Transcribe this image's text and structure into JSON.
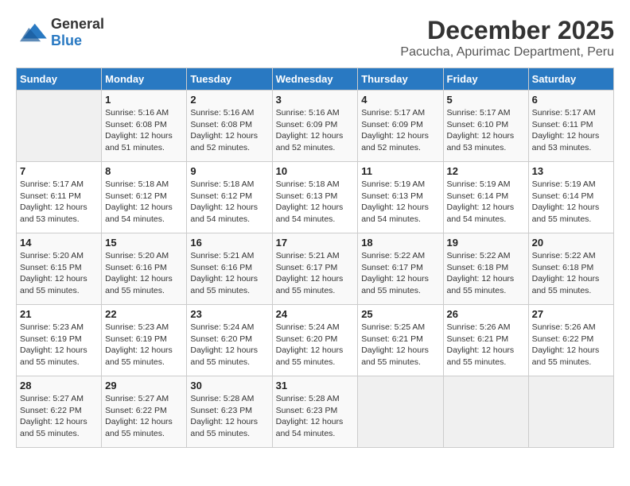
{
  "header": {
    "logo_general": "General",
    "logo_blue": "Blue",
    "month_title": "December 2025",
    "subtitle": "Pacucha, Apurimac Department, Peru"
  },
  "days_of_week": [
    "Sunday",
    "Monday",
    "Tuesday",
    "Wednesday",
    "Thursday",
    "Friday",
    "Saturday"
  ],
  "weeks": [
    [
      {
        "day": "",
        "info": ""
      },
      {
        "day": "1",
        "info": "Sunrise: 5:16 AM\nSunset: 6:08 PM\nDaylight: 12 hours\nand 51 minutes."
      },
      {
        "day": "2",
        "info": "Sunrise: 5:16 AM\nSunset: 6:08 PM\nDaylight: 12 hours\nand 52 minutes."
      },
      {
        "day": "3",
        "info": "Sunrise: 5:16 AM\nSunset: 6:09 PM\nDaylight: 12 hours\nand 52 minutes."
      },
      {
        "day": "4",
        "info": "Sunrise: 5:17 AM\nSunset: 6:09 PM\nDaylight: 12 hours\nand 52 minutes."
      },
      {
        "day": "5",
        "info": "Sunrise: 5:17 AM\nSunset: 6:10 PM\nDaylight: 12 hours\nand 53 minutes."
      },
      {
        "day": "6",
        "info": "Sunrise: 5:17 AM\nSunset: 6:11 PM\nDaylight: 12 hours\nand 53 minutes."
      }
    ],
    [
      {
        "day": "7",
        "info": "Sunrise: 5:17 AM\nSunset: 6:11 PM\nDaylight: 12 hours\nand 53 minutes."
      },
      {
        "day": "8",
        "info": "Sunrise: 5:18 AM\nSunset: 6:12 PM\nDaylight: 12 hours\nand 54 minutes."
      },
      {
        "day": "9",
        "info": "Sunrise: 5:18 AM\nSunset: 6:12 PM\nDaylight: 12 hours\nand 54 minutes."
      },
      {
        "day": "10",
        "info": "Sunrise: 5:18 AM\nSunset: 6:13 PM\nDaylight: 12 hours\nand 54 minutes."
      },
      {
        "day": "11",
        "info": "Sunrise: 5:19 AM\nSunset: 6:13 PM\nDaylight: 12 hours\nand 54 minutes."
      },
      {
        "day": "12",
        "info": "Sunrise: 5:19 AM\nSunset: 6:14 PM\nDaylight: 12 hours\nand 54 minutes."
      },
      {
        "day": "13",
        "info": "Sunrise: 5:19 AM\nSunset: 6:14 PM\nDaylight: 12 hours\nand 55 minutes."
      }
    ],
    [
      {
        "day": "14",
        "info": "Sunrise: 5:20 AM\nSunset: 6:15 PM\nDaylight: 12 hours\nand 55 minutes."
      },
      {
        "day": "15",
        "info": "Sunrise: 5:20 AM\nSunset: 6:16 PM\nDaylight: 12 hours\nand 55 minutes."
      },
      {
        "day": "16",
        "info": "Sunrise: 5:21 AM\nSunset: 6:16 PM\nDaylight: 12 hours\nand 55 minutes."
      },
      {
        "day": "17",
        "info": "Sunrise: 5:21 AM\nSunset: 6:17 PM\nDaylight: 12 hours\nand 55 minutes."
      },
      {
        "day": "18",
        "info": "Sunrise: 5:22 AM\nSunset: 6:17 PM\nDaylight: 12 hours\nand 55 minutes."
      },
      {
        "day": "19",
        "info": "Sunrise: 5:22 AM\nSunset: 6:18 PM\nDaylight: 12 hours\nand 55 minutes."
      },
      {
        "day": "20",
        "info": "Sunrise: 5:22 AM\nSunset: 6:18 PM\nDaylight: 12 hours\nand 55 minutes."
      }
    ],
    [
      {
        "day": "21",
        "info": "Sunrise: 5:23 AM\nSunset: 6:19 PM\nDaylight: 12 hours\nand 55 minutes."
      },
      {
        "day": "22",
        "info": "Sunrise: 5:23 AM\nSunset: 6:19 PM\nDaylight: 12 hours\nand 55 minutes."
      },
      {
        "day": "23",
        "info": "Sunrise: 5:24 AM\nSunset: 6:20 PM\nDaylight: 12 hours\nand 55 minutes."
      },
      {
        "day": "24",
        "info": "Sunrise: 5:24 AM\nSunset: 6:20 PM\nDaylight: 12 hours\nand 55 minutes."
      },
      {
        "day": "25",
        "info": "Sunrise: 5:25 AM\nSunset: 6:21 PM\nDaylight: 12 hours\nand 55 minutes."
      },
      {
        "day": "26",
        "info": "Sunrise: 5:26 AM\nSunset: 6:21 PM\nDaylight: 12 hours\nand 55 minutes."
      },
      {
        "day": "27",
        "info": "Sunrise: 5:26 AM\nSunset: 6:22 PM\nDaylight: 12 hours\nand 55 minutes."
      }
    ],
    [
      {
        "day": "28",
        "info": "Sunrise: 5:27 AM\nSunset: 6:22 PM\nDaylight: 12 hours\nand 55 minutes."
      },
      {
        "day": "29",
        "info": "Sunrise: 5:27 AM\nSunset: 6:22 PM\nDaylight: 12 hours\nand 55 minutes."
      },
      {
        "day": "30",
        "info": "Sunrise: 5:28 AM\nSunset: 6:23 PM\nDaylight: 12 hours\nand 55 minutes."
      },
      {
        "day": "31",
        "info": "Sunrise: 5:28 AM\nSunset: 6:23 PM\nDaylight: 12 hours\nand 54 minutes."
      },
      {
        "day": "",
        "info": ""
      },
      {
        "day": "",
        "info": ""
      },
      {
        "day": "",
        "info": ""
      }
    ]
  ]
}
